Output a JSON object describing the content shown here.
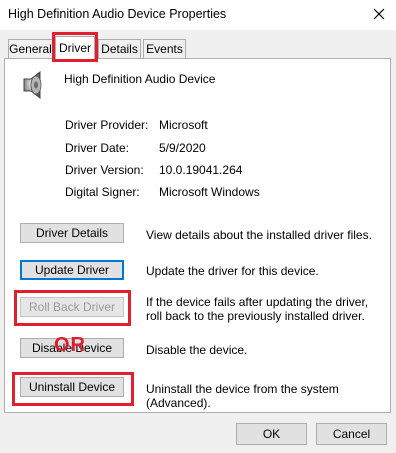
{
  "window": {
    "title": "High Definition Audio Device Properties"
  },
  "tabs": [
    {
      "label": "General"
    },
    {
      "label": "Driver"
    },
    {
      "label": "Details"
    },
    {
      "label": "Events"
    }
  ],
  "device": {
    "name": "High Definition Audio Device",
    "icon": "speaker-icon"
  },
  "properties": [
    {
      "label": "Driver Provider:",
      "value": "Microsoft"
    },
    {
      "label": "Driver Date:",
      "value": "5/9/2020"
    },
    {
      "label": "Driver Version:",
      "value": "10.0.19041.264"
    },
    {
      "label": "Digital Signer:",
      "value": "Microsoft Windows"
    }
  ],
  "actions": [
    {
      "button": "Driver Details",
      "description": "View details about the installed driver files."
    },
    {
      "button": "Update Driver",
      "description": "Update the driver for this device."
    },
    {
      "button": "Roll Back Driver",
      "description": "If the device fails after updating the driver, roll back to the previously installed driver."
    },
    {
      "button": "Disable Device",
      "description": "Disable the device."
    },
    {
      "button": "Uninstall Device",
      "description": "Uninstall the device from the system (Advanced)."
    }
  ],
  "annotation": {
    "or_text": "OR",
    "color": "#e0202e"
  },
  "footer": {
    "ok_label": "OK",
    "cancel_label": "Cancel"
  }
}
